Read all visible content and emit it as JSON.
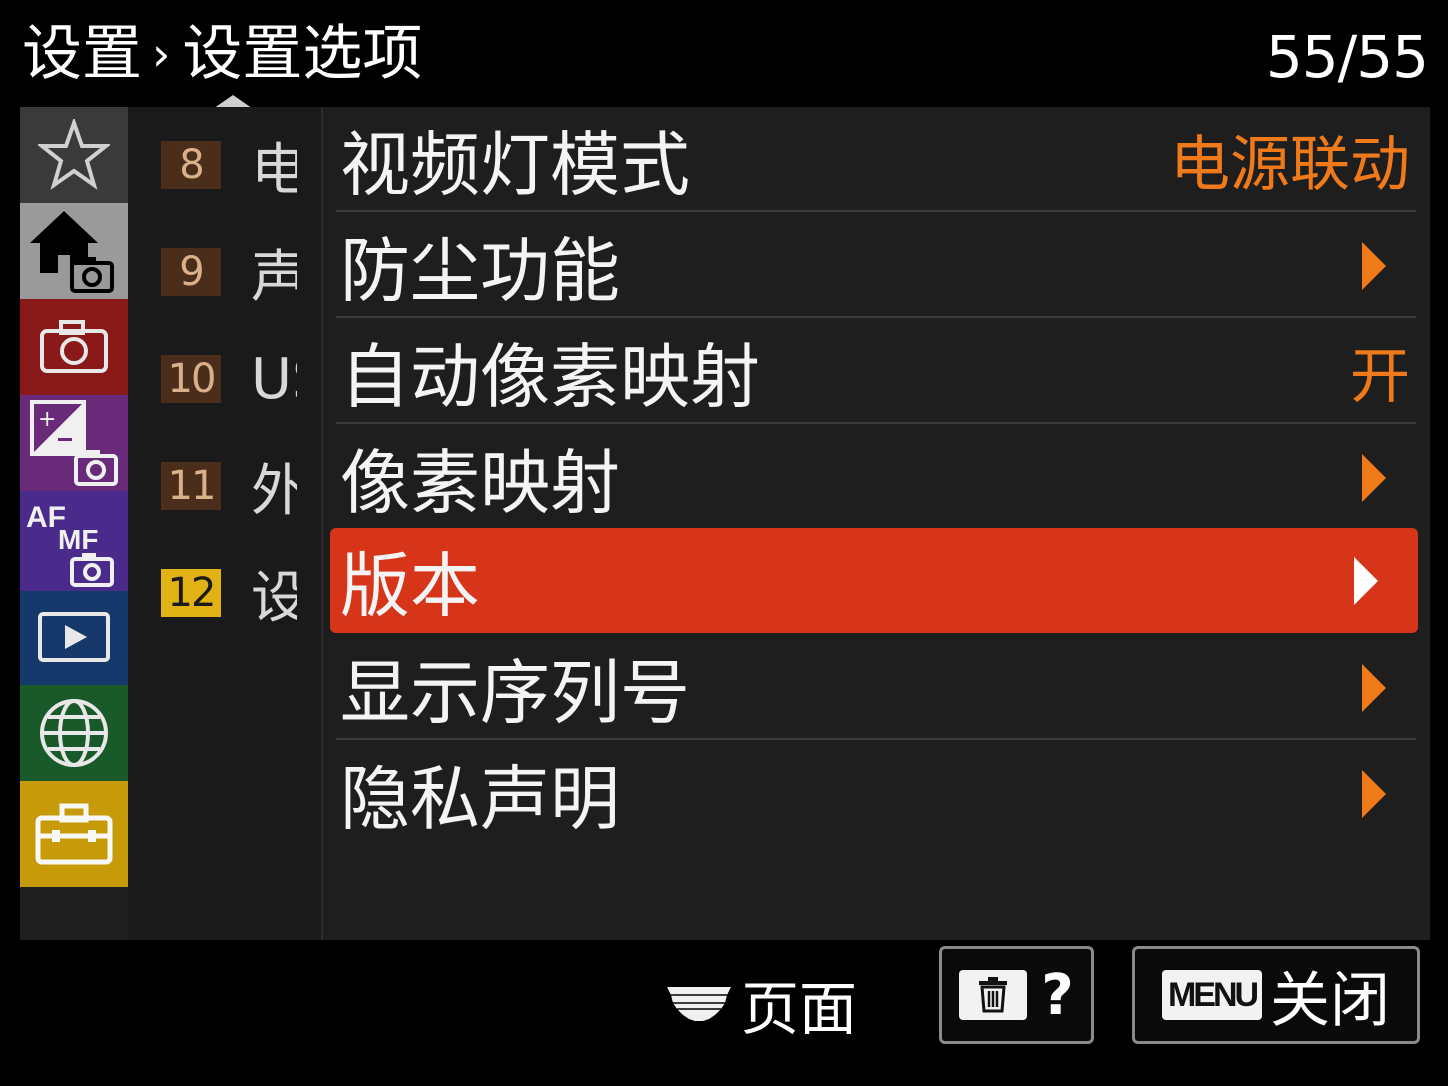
{
  "header": {
    "breadcrumb_parent": "设置",
    "breadcrumb_separator": "›",
    "breadcrumb_current": "设置选项",
    "page_indicator": "55/55"
  },
  "sidebar": {
    "tabs": [
      {
        "name": "favorites",
        "icon": "star-icon",
        "color": "#3a3a3a"
      },
      {
        "name": "main",
        "icon": "home-camera-icon",
        "color": "#9a9a9a"
      },
      {
        "name": "shooting",
        "icon": "camera-icon",
        "color": "#8a1a1a"
      },
      {
        "name": "exposure",
        "icon": "exposure-camera-icon",
        "color": "#6a2a7a"
      },
      {
        "name": "focus",
        "icon": "af-mf-icon",
        "color": "#4a2a8a"
      },
      {
        "name": "playback",
        "icon": "playback-icon",
        "color": "#16386a"
      },
      {
        "name": "network",
        "icon": "globe-icon",
        "color": "#1a5a2a"
      },
      {
        "name": "setup",
        "icon": "toolbox-icon",
        "color": "#c79a0a"
      }
    ],
    "af_label": "AF",
    "mf_label": "MF"
  },
  "subnav": {
    "items": [
      {
        "num": "8",
        "text": "电"
      },
      {
        "num": "9",
        "text": "声"
      },
      {
        "num": "10",
        "text": "US"
      },
      {
        "num": "11",
        "text": "外"
      },
      {
        "num": "12",
        "text": "设"
      }
    ]
  },
  "menu": {
    "items": [
      {
        "label": "视频灯模式",
        "value": "电源联动"
      },
      {
        "label": "防尘功能"
      },
      {
        "label": "自动像素映射",
        "value": "开"
      },
      {
        "label": "像素映射"
      },
      {
        "label": "版本",
        "selected": true
      },
      {
        "label": "显示序列号"
      },
      {
        "label": "隐私声明"
      }
    ]
  },
  "footer": {
    "page_label": "页面",
    "help_label": "?",
    "menu_chip": "MENU",
    "close_label": "关闭"
  },
  "colors": {
    "accent": "#f07a1a",
    "selection": "#d7351a",
    "panel": "#1e1e1e"
  }
}
